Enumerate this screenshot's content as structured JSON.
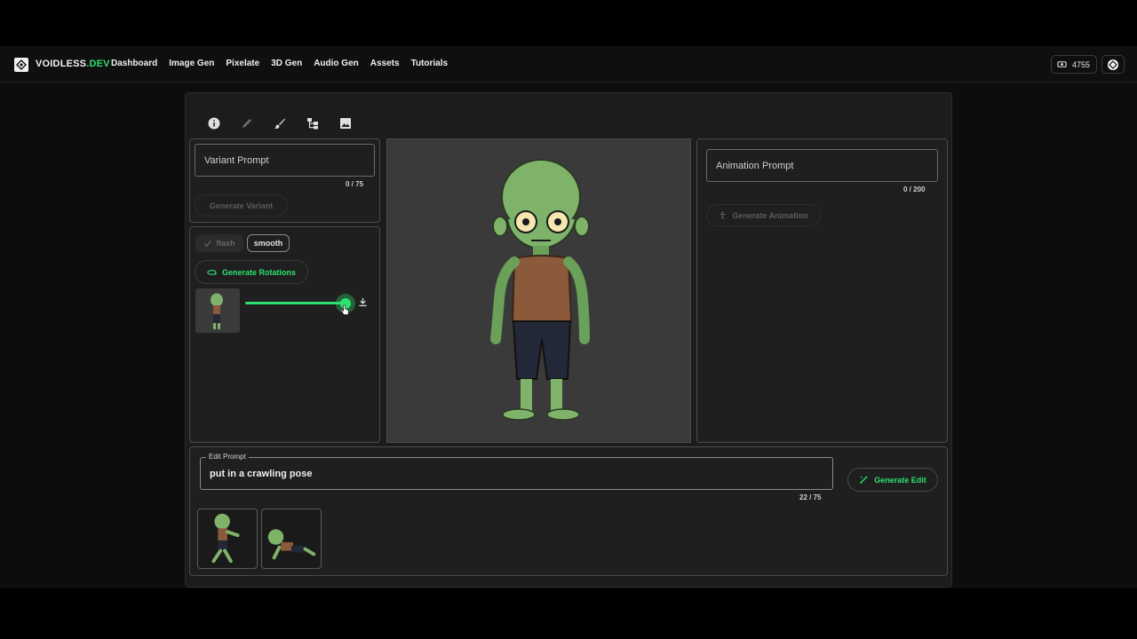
{
  "header": {
    "brand_primary": "VOIDLESS",
    "brand_secondary": ".DEV",
    "nav": [
      "Dashboard",
      "Image Gen",
      "Pixelate",
      "3D Gen",
      "Audio Gen",
      "Assets",
      "Tutorials"
    ],
    "credits": "4755"
  },
  "toolbar": {
    "icons": [
      "info-icon",
      "pencil-icon",
      "brush-icon",
      "tree-icon",
      "image-icon"
    ]
  },
  "variant": {
    "placeholder": "Variant Prompt",
    "counter": "0 / 75",
    "button": "Generate Variant"
  },
  "rotation": {
    "chip_flash": "flash",
    "chip_smooth": "smooth",
    "button": "Generate Rotations",
    "slider_level": 1.0
  },
  "animation": {
    "placeholder": "Animation Prompt",
    "counter": "0 / 200",
    "button": "Generate Animation"
  },
  "edit": {
    "label": "Edit Prompt",
    "value": "put in a crawling pose",
    "counter": "22 / 75",
    "button": "Generate Edit"
  },
  "colors": {
    "accent": "#2ee06f",
    "zombie_skin": "#7fb36a",
    "shirt": "#8a5a3a",
    "pants": "#232838"
  }
}
